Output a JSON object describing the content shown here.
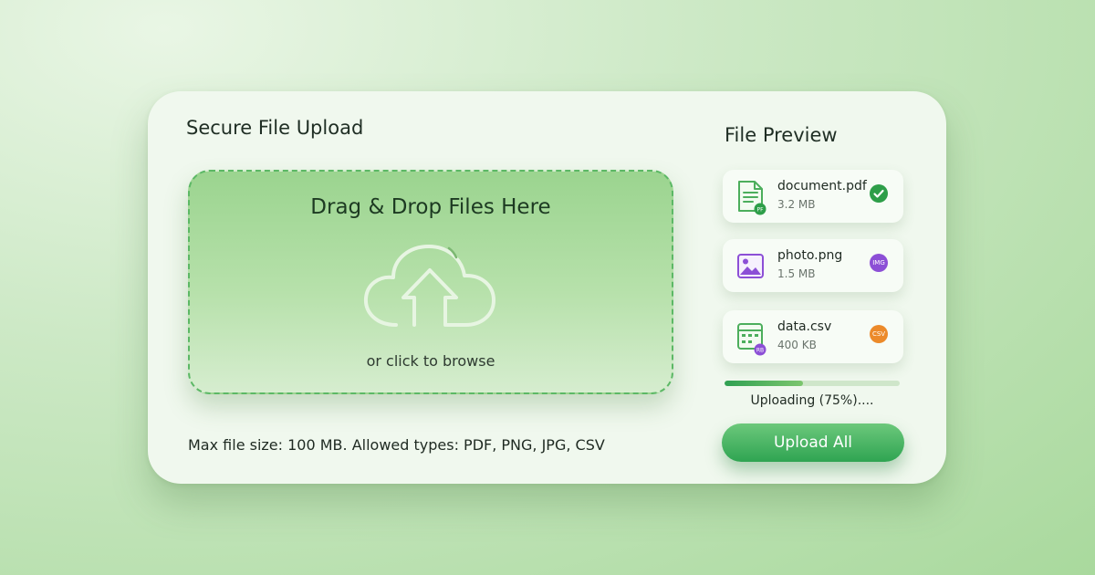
{
  "uploader": {
    "title": "Secure File Upload",
    "dropzone": {
      "title": "Drag & Drop Files Here",
      "browse_text": "or click to browse",
      "icon": "cloud-upload-icon"
    },
    "footnote": "Max file size: 100 MB. Allowed types: PDF, PNG, JPG, CSV"
  },
  "preview": {
    "title": "File Preview",
    "files": [
      {
        "name": "document.pdf",
        "size": "3.2 MB",
        "icon": "pdf-document-icon",
        "icon_tag": "PF",
        "status": "check-icon",
        "status_color": "#2e9e49"
      },
      {
        "name": "photo.png",
        "size": "1.5 MB",
        "icon": "image-icon",
        "status": "IMG",
        "status_color": "#8c4fd6"
      },
      {
        "name": "data.csv",
        "size": "400 KB",
        "icon": "spreadsheet-icon",
        "icon_tag": "RB",
        "status": "CSV",
        "status_color": "#ec8a2a"
      }
    ],
    "progress": {
      "fill_fraction": 0.45,
      "text": "Uploading (75%)...."
    },
    "upload_button_label": "Upload All"
  },
  "colors": {
    "accent": "#2fa452",
    "dropzone_border": "#5cb865",
    "card_background": "#f0f8ee"
  }
}
